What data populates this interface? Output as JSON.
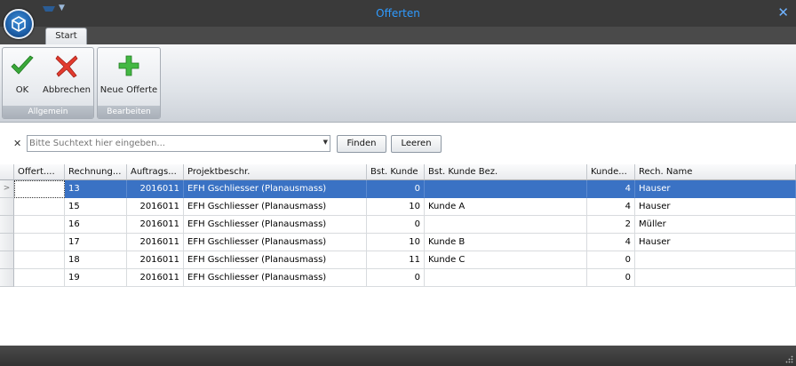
{
  "window": {
    "title": "Offerten"
  },
  "ribbon": {
    "tabs": [
      {
        "label": "Start"
      }
    ],
    "groups": [
      {
        "caption": "Allgemein",
        "buttons": [
          {
            "label": "OK",
            "icon": "checkmark-icon"
          },
          {
            "label": "Abbrechen",
            "icon": "red-x-icon"
          }
        ]
      },
      {
        "caption": "Bearbeiten",
        "buttons": [
          {
            "label": "Neue Offerte",
            "icon": "green-plus-icon"
          }
        ]
      }
    ]
  },
  "search": {
    "placeholder": "Bitte Suchtext hier eingeben...",
    "value": "",
    "find_label": "Finden",
    "clear_label": "Leeren"
  },
  "grid": {
    "columns": [
      "Offert....",
      "Rechnung...",
      "Auftrags...",
      "Projektbeschr.",
      "Bst. Kunde",
      "Bst. Kunde Bez.",
      "Kunde...",
      "Rech. Name"
    ],
    "rows": [
      [
        "",
        "13",
        "2016011",
        "EFH Gschliesser (Planausmass)",
        "0",
        "",
        "4",
        "Hauser"
      ],
      [
        "",
        "15",
        "2016011",
        "EFH Gschliesser (Planausmass)",
        "10",
        "Kunde A",
        "4",
        "Hauser"
      ],
      [
        "",
        "16",
        "2016011",
        "EFH Gschliesser (Planausmass)",
        "0",
        "",
        "2",
        "Müller"
      ],
      [
        "",
        "17",
        "2016011",
        "EFH Gschliesser (Planausmass)",
        "10",
        "Kunde B",
        "4",
        "Hauser"
      ],
      [
        "",
        "18",
        "2016011",
        "EFH Gschliesser (Planausmass)",
        "11",
        "Kunde C",
        "0",
        ""
      ],
      [
        "",
        "19",
        "2016011",
        "EFH Gschliesser (Planausmass)",
        "0",
        "",
        "0",
        ""
      ]
    ],
    "selected_row": 0,
    "current_row_marker": ">"
  },
  "colors": {
    "accent": "#2f9bff",
    "selection": "#3a72c4",
    "titlebar": "#3a3a3a"
  }
}
